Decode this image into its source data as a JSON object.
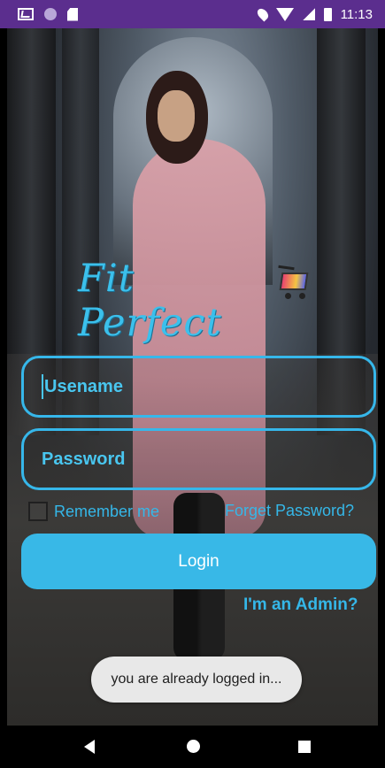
{
  "status_bar": {
    "time": "11:13",
    "icons": [
      "gmail-icon",
      "circle-notification-icon",
      "sd-card-icon",
      "location-icon",
      "wifi-icon",
      "signal-icon",
      "battery-icon"
    ]
  },
  "app": {
    "logo_text": "Fit Perfect",
    "username_placeholder": "Usename",
    "password_placeholder": "Password",
    "remember_label": "Remember me",
    "forgot_label": "Forget Password?",
    "login_label": "Login",
    "admin_label": "I'm an Admin?",
    "toast": "you are already logged in..."
  },
  "colors": {
    "accent": "#38b8e7",
    "status_bar": "#5b2e8e",
    "toast_background": "#e8e8e8"
  }
}
